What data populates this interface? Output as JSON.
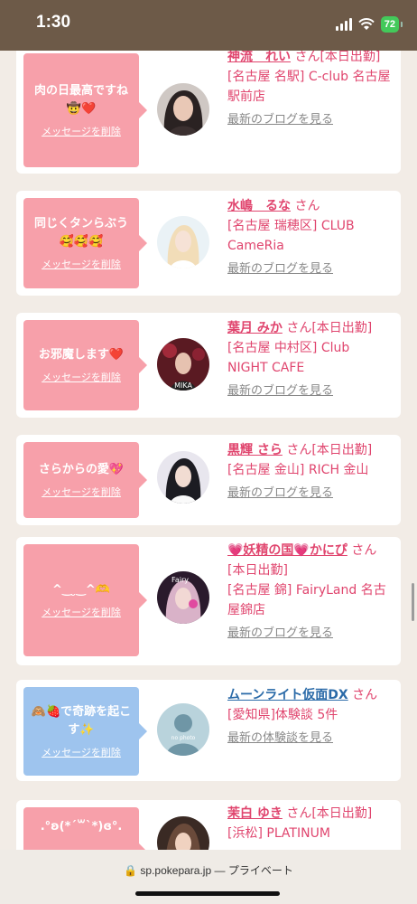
{
  "status_bar": {
    "time": "1:30",
    "battery": "72"
  },
  "colors": {
    "pink_bubble": "#f7a0aa",
    "blue_bubble": "#9ec4ee",
    "name_pink": "#e0456e",
    "name_blue": "#2a6aa8"
  },
  "cards": [
    {
      "message": "肉の日最高ですね",
      "emoji": "🤠❤️",
      "delete": "メッセージを削除",
      "name": "神流　れい",
      "san": "さん",
      "tag": "[本日出勤]",
      "store": "[名古屋 名駅] C-club 名古屋駅前店",
      "link": "最新のブログを見る"
    },
    {
      "message": "同じくタンらぶう",
      "emoji": "🥰🥰🥰",
      "delete": "メッセージを削除",
      "name": "水嶋　るな",
      "san": "さん",
      "tag": "",
      "store": "[名古屋 瑞穂区] CLUB CameRia",
      "link": "最新のブログを見る"
    },
    {
      "message": "お邪魔します❤️",
      "emoji": "",
      "delete": "メッセージを削除",
      "name": "葉月 みか",
      "san": "さん",
      "tag": "[本日出勤]",
      "store": "[名古屋 中村区] Club NIGHT CAFE",
      "link": "最新のブログを見る"
    },
    {
      "message": "さらからの愛💖",
      "emoji": "",
      "delete": "メッセージを削除",
      "name": "黒輝 さら",
      "san": "さん",
      "tag": "[本日出勤]",
      "store": "[名古屋 金山] RICH 金山",
      "link": "最新のブログを見る"
    },
    {
      "message": "^‿ ̮‿^🫶",
      "emoji": "",
      "delete": "メッセージを削除",
      "name": "💗妖精の国💗かにぴ",
      "san": "さん",
      "tag": "[本日出勤]",
      "store": "[名古屋 錦] FairyLand 名古屋錦店",
      "link": "最新のブログを見る"
    },
    {
      "message": "🙈🍓で奇跡を起こす✨",
      "emoji": "",
      "delete": "メッセージを削除",
      "name": "ムーンライト仮面DX",
      "san": "さん",
      "tag": "",
      "store": "[愛知県]体験談 5件",
      "link": "最新の体験談を見る"
    },
    {
      "message": ".°ʚ(*´꒳`*)ɞ°.",
      "emoji": "",
      "delete": "",
      "name": "茉白 ゆき",
      "san": "さん",
      "tag": "[本日出勤]",
      "store": "[浜松] PLATINUM",
      "link": ""
    }
  ],
  "url_bar": {
    "domain": "sp.pokepara.jp",
    "separator": "—",
    "mode": "プライベート"
  }
}
